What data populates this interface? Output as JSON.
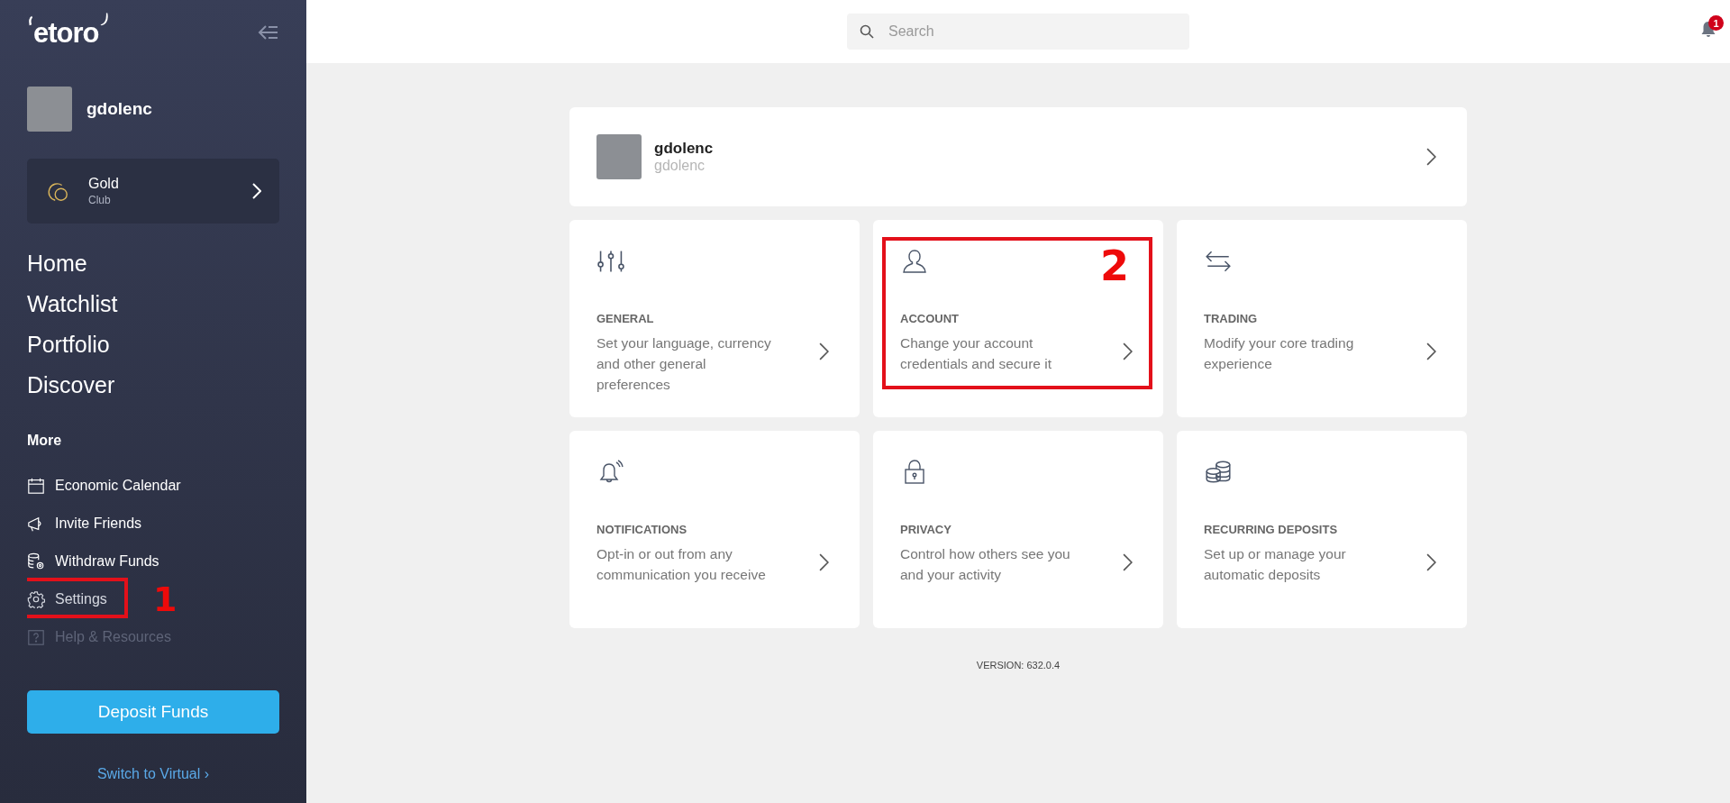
{
  "sidebar": {
    "logo": "etoro",
    "user": {
      "name": "gdolenc"
    },
    "club": {
      "title": "Gold",
      "subtitle": "Club"
    },
    "main_nav": [
      {
        "label": "Home"
      },
      {
        "label": "Watchlist"
      },
      {
        "label": "Portfolio"
      },
      {
        "label": "Discover"
      }
    ],
    "more_heading": "More",
    "more_items": [
      {
        "label": "Economic Calendar",
        "selected": false,
        "faded": false
      },
      {
        "label": "Invite Friends",
        "selected": false,
        "faded": false
      },
      {
        "label": "Withdraw Funds",
        "selected": false,
        "faded": false
      },
      {
        "label": "Settings",
        "selected": true,
        "faded": false,
        "callout": "1"
      },
      {
        "label": "Help & Resources",
        "selected": false,
        "faded": true
      }
    ],
    "deposit_button": "Deposit Funds",
    "switch_link": "Switch to Virtual ›"
  },
  "header": {
    "search": {
      "placeholder": "Search"
    },
    "notifications": {
      "count": "1"
    }
  },
  "profile_card": {
    "name": "gdolenc",
    "username": "gdolenc"
  },
  "settings_cards": [
    {
      "title": "GENERAL",
      "description": "Set your language, currency and other general preferences"
    },
    {
      "title": "ACCOUNT",
      "description": "Change your account credentials and secure it",
      "callout": "2"
    },
    {
      "title": "TRADING",
      "description": "Modify your core trading experience"
    },
    {
      "title": "NOTIFICATIONS",
      "description": "Opt-in or out from any communication you receive"
    },
    {
      "title": "PRIVACY",
      "description": "Control how others see you and your activity"
    },
    {
      "title": "RECURRING DEPOSITS",
      "description": "Set up or manage your automatic deposits"
    }
  ],
  "version": "VERSION: 632.0.4"
}
